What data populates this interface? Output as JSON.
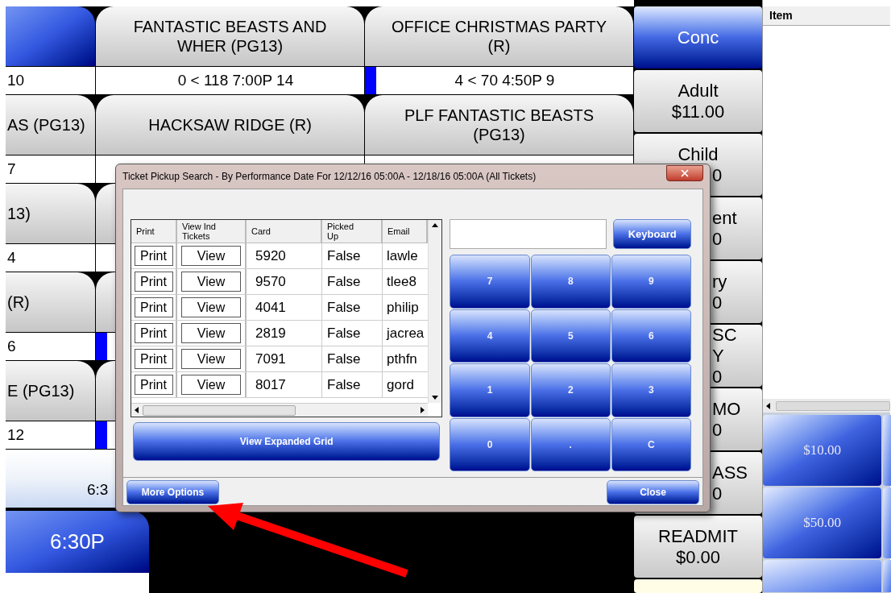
{
  "movie_grid": {
    "rows": [
      {
        "tiles": [
          {
            "selected": true
          },
          {
            "title": "FANTASTIC BEASTS AND WHER (PG13)",
            "selected": false
          },
          {
            "title": "OFFICE CHRISTMAS PARTY (R)",
            "selected": false
          }
        ],
        "infos": [
          {
            "text": "10",
            "marked": false
          },
          {
            "text": "0 < 118 7:00P 14",
            "marked": false
          },
          {
            "text": "4 < 70 4:50P 9",
            "marked": true
          }
        ]
      },
      {
        "tiles": [
          {
            "title": "AS (PG13)",
            "selected": false
          },
          {
            "title": "HACKSAW RIDGE (R)",
            "selected": false
          },
          {
            "title": "PLF FANTASTIC BEASTS (PG13)",
            "selected": false
          }
        ],
        "infos": [
          {
            "text": "7",
            "marked": false
          },
          {
            "marked": false
          },
          {
            "marked": false
          }
        ]
      },
      {
        "tiles": [
          {
            "title": "13)",
            "selected": false
          },
          {
            "selected": false
          }
        ],
        "infos": [
          {
            "text": "4",
            "marked": false
          },
          {
            "marked": false
          }
        ]
      },
      {
        "tiles": [
          {
            "title": "(R)",
            "selected": false
          },
          {
            "selected": false
          }
        ],
        "infos": [
          {
            "text": "6",
            "marked": false
          },
          {
            "marked": true
          }
        ]
      },
      {
        "tiles": [
          {
            "title": "E (PG13)",
            "selected": false
          },
          {
            "selected": false
          }
        ],
        "infos": [
          {
            "text": "12",
            "marked": false
          },
          {
            "marked": true
          }
        ]
      }
    ]
  },
  "showtime_label": "6:3",
  "showtime_button": "6:30P",
  "ticket_buttons": [
    {
      "lines": [
        "Conc"
      ],
      "selected": true
    },
    {
      "lines": [
        "Adult",
        "$11.00"
      ],
      "selected": false
    },
    {
      "lines": [
        "Child",
        "0"
      ],
      "selected": false
    },
    {
      "lines": [
        "ent",
        "0"
      ],
      "selected": false
    },
    {
      "lines": [
        "ry",
        "0"
      ],
      "selected": false
    },
    {
      "lines": [
        "SC",
        "Y",
        "0"
      ],
      "selected": false
    },
    {
      "lines": [
        "MO",
        "0"
      ],
      "selected": false
    },
    {
      "lines": [
        "ASS",
        "0"
      ],
      "selected": false
    },
    {
      "lines": [
        "READMIT",
        "$0.00"
      ],
      "selected": false
    }
  ],
  "item_panel": {
    "header": "Item",
    "tenders": [
      "$10.00",
      "$50.00"
    ]
  },
  "dialog": {
    "title": "Ticket Pickup Search - By Performance Date For 12/12/16 05:00A - 12/18/16 05:00A (All Tickets)",
    "columns": [
      "Print",
      "View Ind Tickets",
      "Card",
      "Picked Up",
      "Email"
    ],
    "rows": [
      {
        "print": "Print",
        "view": "View",
        "card": "5920",
        "picked_up": "False",
        "email": "lawle"
      },
      {
        "print": "Print",
        "view": "View",
        "card": "9570",
        "picked_up": "False",
        "email": "tlee8"
      },
      {
        "print": "Print",
        "view": "View",
        "card": "4041",
        "picked_up": "False",
        "email": "philip"
      },
      {
        "print": "Print",
        "view": "View",
        "card": "2819",
        "picked_up": "False",
        "email": "jacrea"
      },
      {
        "print": "Print",
        "view": "View",
        "card": "7091",
        "picked_up": "False",
        "email": "pthfn"
      },
      {
        "print": "Print",
        "view": "View",
        "card": "8017",
        "picked_up": "False",
        "email": "gord"
      }
    ],
    "expanded_button": "View Expanded Grid",
    "keyboard_button": "Keyboard",
    "keypad": [
      "7",
      "8",
      "9",
      "4",
      "5",
      "6",
      "1",
      "2",
      "3",
      "0",
      ".",
      "C"
    ],
    "more_options": "More Options",
    "close": "Close"
  }
}
